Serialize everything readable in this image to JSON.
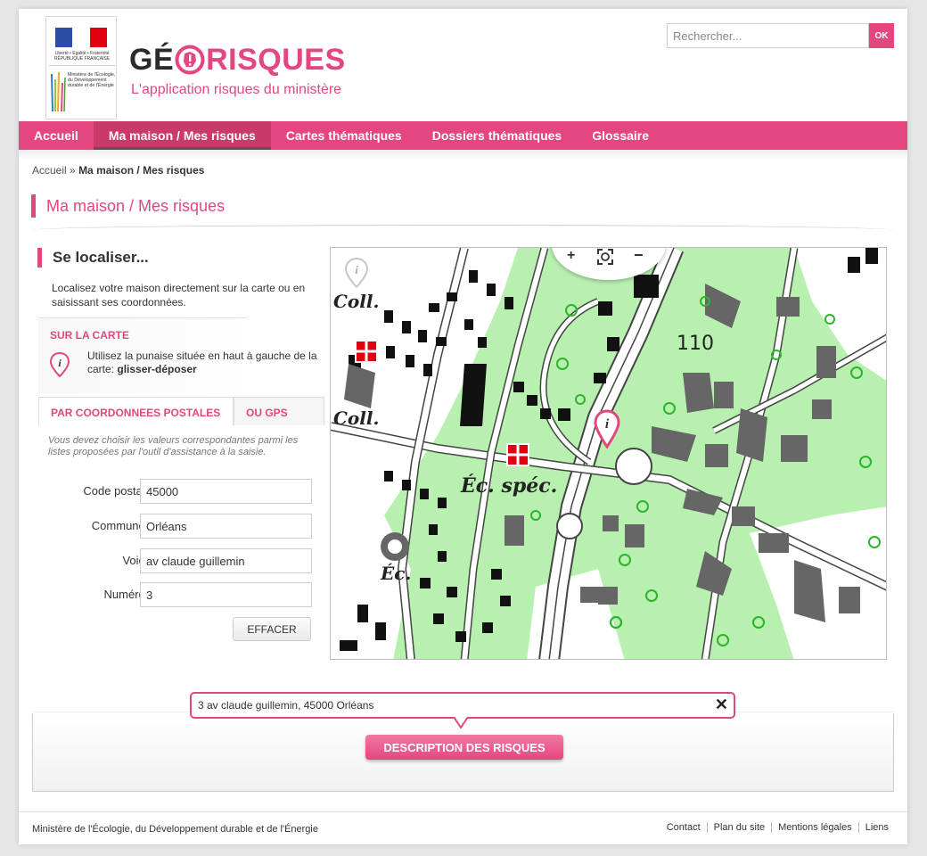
{
  "header": {
    "rf_text": "Liberté • Égalité • Fraternité RÉPUBLIQUE FRANÇAISE",
    "ministry_logo_text": "Ministère de l'Écologie, du Développement durable et de l'Énergie",
    "brand_left": "GÉ",
    "brand_right": "RISQUES",
    "tagline": "L'application risques du ministère",
    "search_placeholder": "Rechercher...",
    "search_button": "OK"
  },
  "nav": {
    "items": [
      {
        "label": "Accueil"
      },
      {
        "label": "Ma maison / Mes risques",
        "active": true
      },
      {
        "label": "Cartes thématiques"
      },
      {
        "label": "Dossiers thématiques"
      },
      {
        "label": "Glossaire"
      }
    ]
  },
  "breadcrumb": {
    "home": "Accueil",
    "sep": "»",
    "current": "Ma maison / Mes risques"
  },
  "page_title": "Ma maison / Mes risques",
  "locate": {
    "title": "Se localiser...",
    "intro": "Localisez votre maison directement sur la carte ou en saisissant ses coordonnées.",
    "map_section_label": "SUR LA CARTE",
    "map_section_text": "Utilisez la punaise située en haut à gauche de la carte: ",
    "map_section_bold": "glisser-déposer",
    "tabs": [
      {
        "label": "PAR COORDONNEES POSTALES",
        "active": true
      },
      {
        "label": "OU GPS"
      }
    ],
    "hint": "Vous devez choisir les valeurs correspondantes parmi les listes proposées par l'outil d'assistance à la saisie.",
    "fields": {
      "postal_code": {
        "label": "Code postal :",
        "value": "45000"
      },
      "commune": {
        "label": "Commune :",
        "value": "Orléans"
      },
      "voie": {
        "label": "Voie :",
        "value": "av claude guillemin"
      },
      "numero": {
        "label": "Numéro :",
        "value": "3"
      }
    },
    "clear_button": "EFFACER"
  },
  "map": {
    "zoom_in": "+",
    "zoom_out": "−",
    "labels": {
      "coll_top": "Coll.",
      "coll_mid": "Coll.",
      "ec_spec": "Éc. spéc.",
      "ec": "Éc.",
      "elevation": "110"
    }
  },
  "result": {
    "address": "3 av claude guillemin, 45000 Orléans",
    "close": "✕",
    "risk_button": "DESCRIPTION DES RISQUES"
  },
  "footer": {
    "ministry": "Ministère de l'Écologie, du Développement durable et de l'Énergie",
    "links": [
      "Contact",
      "Plan du site",
      "Mentions légales",
      "Liens"
    ]
  },
  "colors": {
    "accent": "#e4467f",
    "map_green": "#b8f0b0",
    "building": "#666666"
  }
}
